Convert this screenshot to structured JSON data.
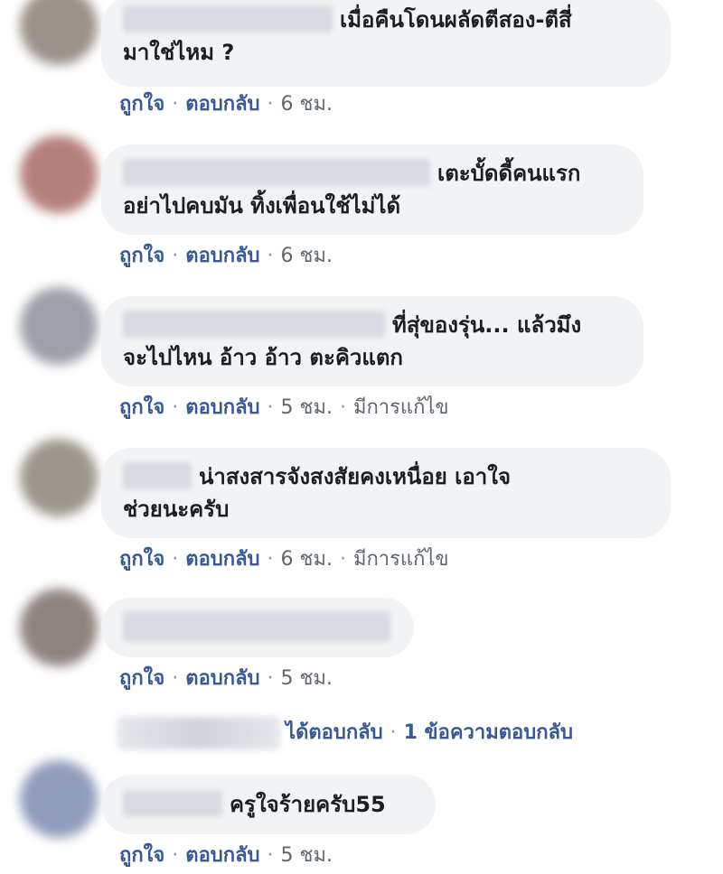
{
  "actions": {
    "like": "ถูกใจ",
    "reply": "ตอบกลับ",
    "separator": "·",
    "edited": "มีการแก้ไข"
  },
  "comments": [
    {
      "avatar_color": "#8a7f76",
      "lines": [
        "เมื่อคืนโดนผลัดตีสอง-ตีสี่",
        "มาใช่ไหม ?"
      ],
      "time": "6 ชม."
    },
    {
      "avatar_color": "#a86a66",
      "lines": [
        "เตะบั้ดดี้คนแรก",
        "อย่าไปคบมัน ทิ้งเพื่อนใช้ไม่ได้"
      ],
      "time": "6 ชม."
    },
    {
      "avatar_color": "#8c9099",
      "lines": [
        "ที่สุ่ของรุ่น... แล้วมึง",
        "จะไปไหน อ้าว อ้าว ตะคิวแตก"
      ],
      "time": "5 ชม."
    },
    {
      "avatar_color": "#8b857a",
      "lines": [
        "น่าสงสารจังสงสัยคงเหนื่อย เอาใจ",
        "ช่วยนะครับ"
      ],
      "time": "6 ชม."
    },
    {
      "avatar_color": "#7c6f6a",
      "lines": [],
      "time": "5 ชม."
    },
    {
      "avatar_color": "#7f8cb0",
      "lines": [
        "ครูใจร้ายครับ55"
      ],
      "time": "5 ชม."
    }
  ],
  "replies": {
    "replied_text": "ได้ตอบกลับ",
    "separator": "·",
    "count_text": "1 ข้อความตอบกลับ"
  }
}
